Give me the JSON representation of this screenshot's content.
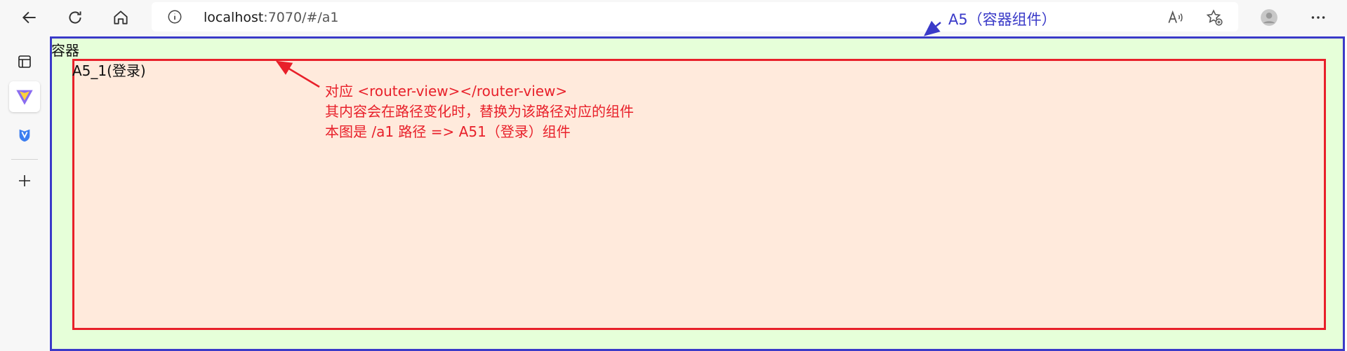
{
  "browser": {
    "url_host": "localhost",
    "url_rest": ":7070/#/a1",
    "icons": [
      "back-icon",
      "refresh-icon",
      "home-icon",
      "info-icon",
      "read-aloud-icon",
      "add-favorite-icon",
      "profile-icon",
      "more-icon"
    ]
  },
  "sidebar": {
    "icons": [
      "tab-actions-icon",
      "vite-icon",
      "vue-devtools-icon",
      "add-icon"
    ]
  },
  "page": {
    "container_label": "容器",
    "router_view_label": "A5_1(登录)"
  },
  "annotations": {
    "blue": "A5（容器组件）",
    "red_line1": "对应 <router-view></router-view>",
    "red_line2": "其内容会在路径变化时，替换为该路径对应的组件",
    "red_line3": "本图是 /a1 路径 => A51（登录）组件"
  },
  "colors": {
    "container_border": "#3a3ac8",
    "container_bg": "#e6ffd9",
    "router_border": "#e8202a",
    "router_bg": "#ffeadc"
  }
}
